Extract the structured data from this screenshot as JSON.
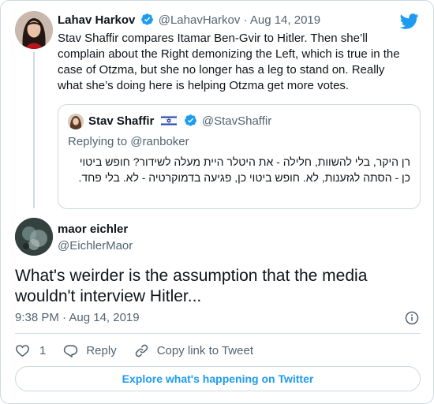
{
  "parent_tweet": {
    "author_name": "Lahav Harkov",
    "handle": "@LahavHarkov",
    "separator": "·",
    "date": "Aug 14, 2019",
    "text": "Stav Shaffir compares Itamar Ben-Gvir to Hitler. Then she’ll complain about the Right demonizing the Left, which is true in the case of Otzma, but she no longer has a leg to stand on. Really what she’s doing here is helping Otzma get more votes."
  },
  "quoted_tweet": {
    "author_name": "Stav Shaffir",
    "handle": "@StavShaffir",
    "replying_to": "Replying to @ranboker",
    "text": "רן היקר, בלי להשוות, חלילה - את היטלר היית מעלה לשידור? חופש ביטוי כן - הסתה לגזענות, לא. חופש ביטוי כן, פגיעה בדמוקרטיה - לא. בלי פחד."
  },
  "main_tweet": {
    "author_name": "maor eichler",
    "handle": "@EichlerMaor",
    "text": "What's weirder is the assumption that the media wouldn't interview Hitler...",
    "timestamp": "9:38 PM · Aug 14, 2019"
  },
  "actions": {
    "like_count": "1",
    "reply_label": "Reply",
    "copy_link_label": "Copy link to Tweet"
  },
  "footer": {
    "explore_label": "Explore what's happening on Twitter"
  },
  "colors": {
    "accent": "#1d9bf0",
    "secondary_text": "#536471",
    "border": "#cfd9de"
  },
  "icons": [
    "twitter-bird-icon",
    "verified-badge-icon",
    "israel-flag-icon",
    "info-icon",
    "heart-icon",
    "reply-icon",
    "link-icon"
  ]
}
